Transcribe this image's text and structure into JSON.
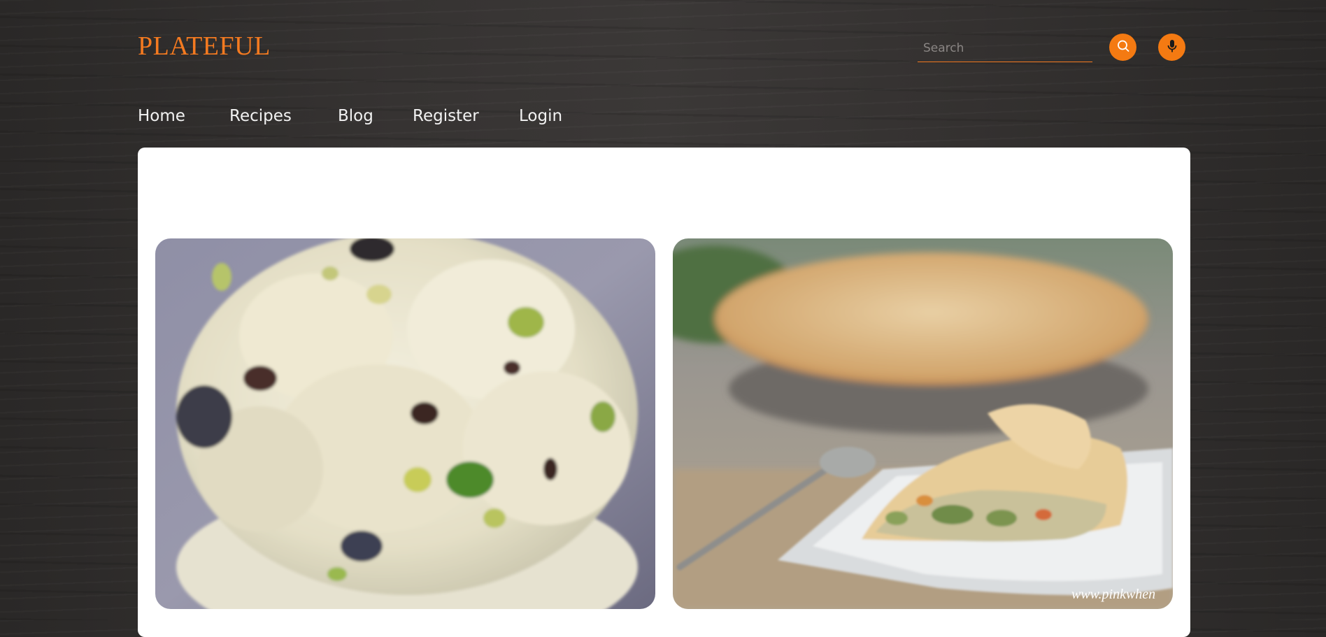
{
  "header": {
    "logo": "PLATEFUL",
    "search": {
      "placeholder": "Search",
      "value": ""
    },
    "search_button_icon": "search-icon",
    "mic_button_icon": "mic-icon"
  },
  "nav": {
    "items": [
      {
        "label": "Home"
      },
      {
        "label": "Recipes"
      },
      {
        "label": "Blog"
      },
      {
        "label": "Register"
      },
      {
        "label": "Login"
      }
    ]
  },
  "cards": [
    {
      "image": "pistachio-ice-cream-photo"
    },
    {
      "image": "chicken-pot-pie-photo",
      "watermark": "www.pinkwhen"
    }
  ],
  "colors": {
    "accent": "#f47a20",
    "background": "#333030",
    "panel": "#ffffff"
  }
}
